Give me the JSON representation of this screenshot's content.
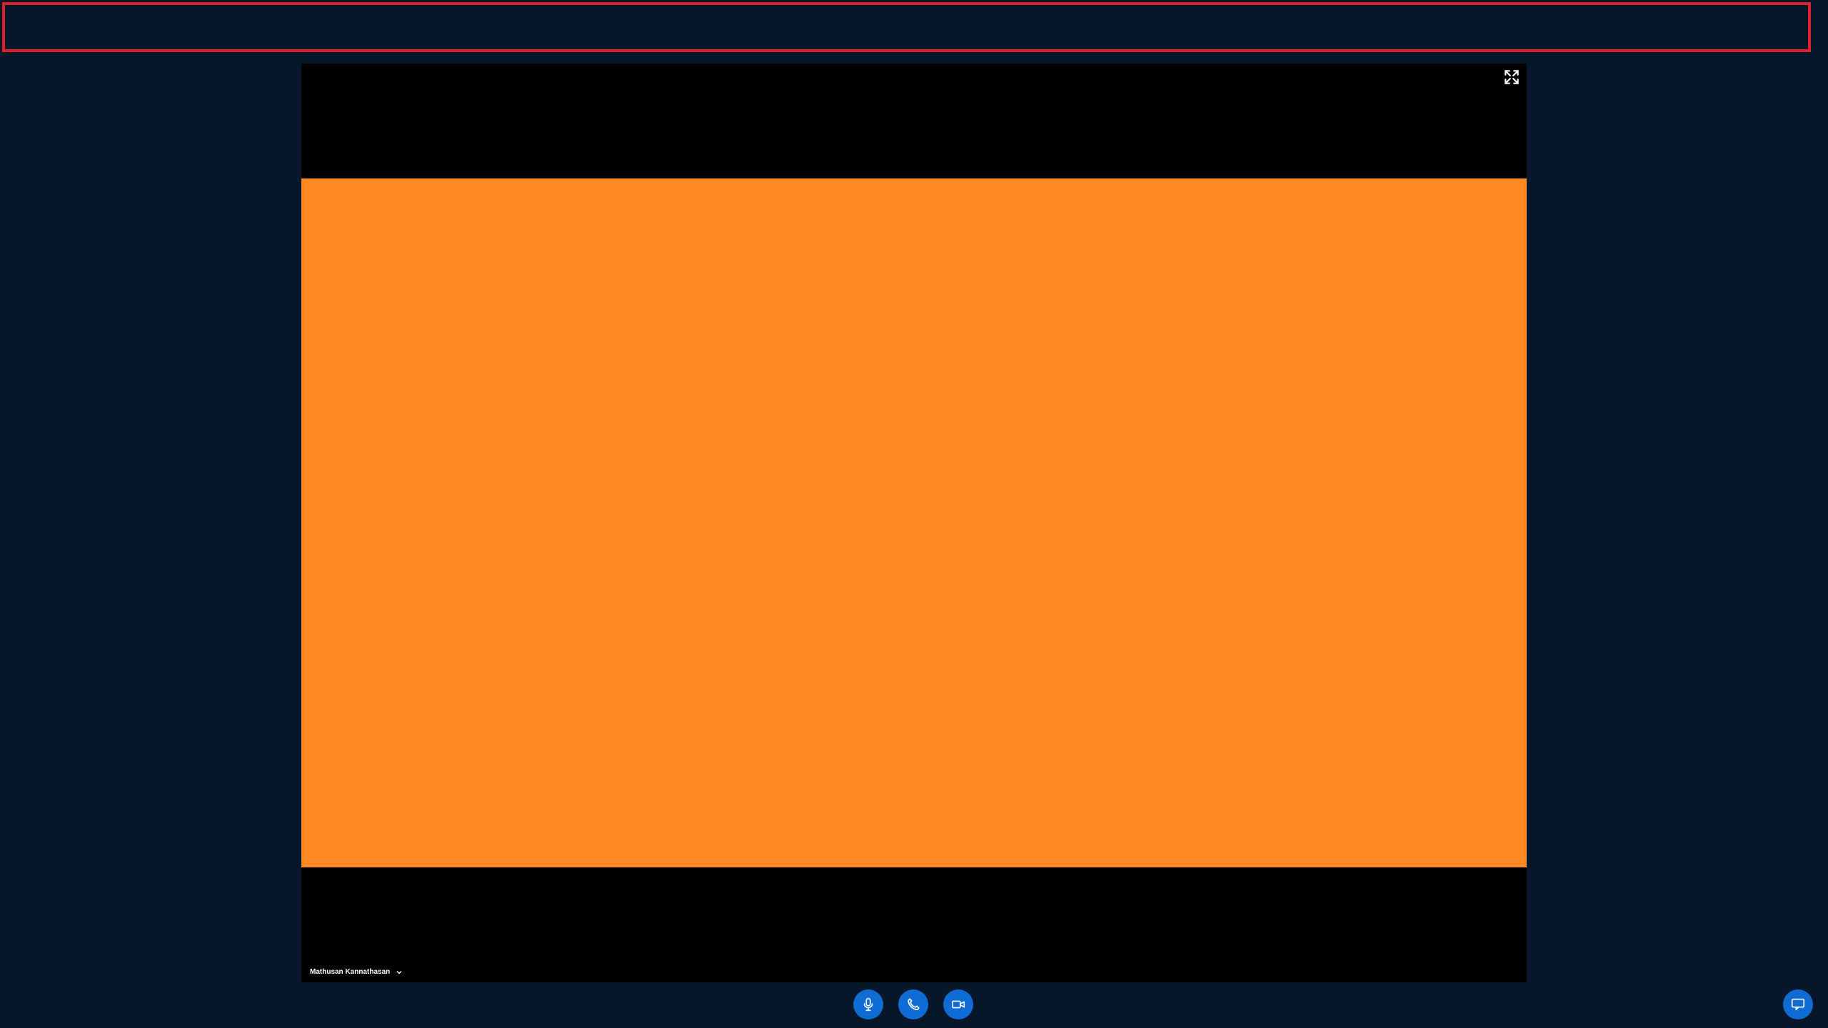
{
  "colors": {
    "background": "#07172a",
    "highlight_border": "#e0202b",
    "stage": "#000000",
    "video_feed": "#ff8a25",
    "control_button": "#0f6cd4",
    "icon": "#ffffff"
  },
  "video": {
    "participant_name": "Mathusan Kannathasan",
    "fullscreen_icon": "fullscreen-icon",
    "participant_menu_icon": "chevron-down-icon"
  },
  "controls": [
    {
      "name": "mute-microphone-button",
      "icon": "microphone-icon"
    },
    {
      "name": "end-call-button",
      "icon": "phone-icon"
    },
    {
      "name": "toggle-camera-button",
      "icon": "video-camera-icon"
    }
  ],
  "chat_button": {
    "icon": "chat-icon"
  }
}
